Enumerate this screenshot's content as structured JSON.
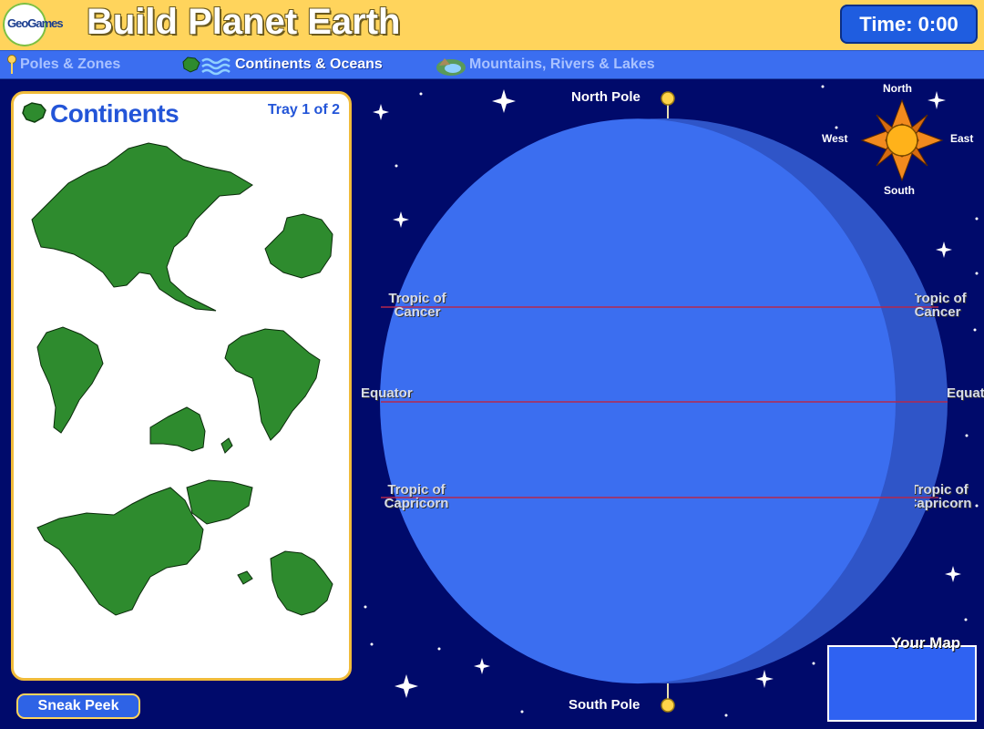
{
  "header": {
    "logo_text": "GeoGames",
    "title": "Build Planet Earth",
    "timer": "Time: 0:00"
  },
  "tabs": [
    {
      "label": "Poles & Zones",
      "icon": "pushpin-icon",
      "active": false
    },
    {
      "label": "Continents & Oceans",
      "icon": "continents-oceans-icon",
      "active": true
    },
    {
      "label": "Mountains, Rivers & Lakes",
      "icon": "mountains-rivers-lakes-icon",
      "active": false
    }
  ],
  "tray": {
    "title": "Continents",
    "counter": "Tray 1 of 2",
    "pieces": [
      "Asia",
      "Antarctica",
      "South America",
      "Africa",
      "Australia",
      "North America",
      "Europe"
    ]
  },
  "globe": {
    "north_pole": "North Pole",
    "south_pole": "South Pole",
    "tropic_cancer": [
      "Tropic of",
      "Cancer"
    ],
    "equator": "Equator",
    "tropic_capricorn": [
      "Tropic of",
      "Capricorn"
    ]
  },
  "compass": {
    "north": "North",
    "south": "South",
    "east": "East",
    "west": "West"
  },
  "buttons": {
    "sneak_peek": "Sneak Peek"
  },
  "your_map": {
    "label": "Your Map"
  },
  "colors": {
    "background": "#000a6b",
    "header": "#ffd45c",
    "tab_bar": "#3b6ef0",
    "globe": "#3b6ef0",
    "land": "#2e8b2e",
    "line": "#b4284d"
  }
}
